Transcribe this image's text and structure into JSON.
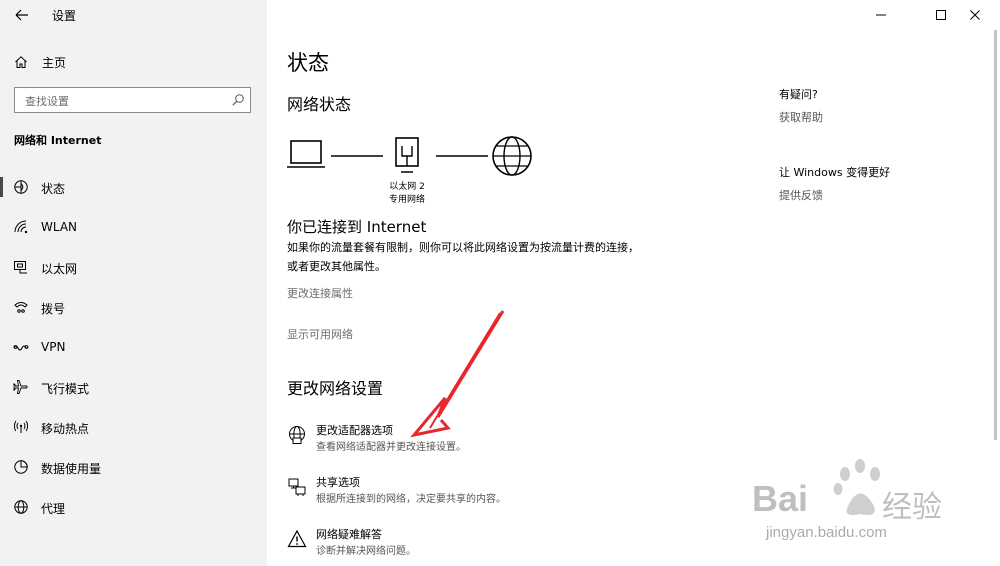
{
  "window": {
    "title": "设置",
    "controls": {
      "minimize": "minimize-icon",
      "maximize": "maximize-icon",
      "close": "close-icon"
    }
  },
  "sidebar": {
    "home_label": "主页",
    "search_placeholder": "查找设置",
    "section_title": "网络和 Internet",
    "items": [
      {
        "label": "状态",
        "icon": "status-icon",
        "active": true
      },
      {
        "label": "WLAN",
        "icon": "wifi-icon"
      },
      {
        "label": "以太网",
        "icon": "ethernet-icon"
      },
      {
        "label": "拨号",
        "icon": "dialup-icon"
      },
      {
        "label": "VPN",
        "icon": "vpn-icon"
      },
      {
        "label": "飞行模式",
        "icon": "airplane-icon"
      },
      {
        "label": "移动热点",
        "icon": "hotspot-icon"
      },
      {
        "label": "数据使用量",
        "icon": "data-usage-icon"
      },
      {
        "label": "代理",
        "icon": "proxy-icon"
      }
    ]
  },
  "main": {
    "page_title": "状态",
    "network_status_heading": "网络状态",
    "diagram": {
      "adapter_name": "以太网 2",
      "network_type": "专用网络"
    },
    "connected_title": "你已连接到 Internet",
    "connected_desc": "如果你的流量套餐有限制，则你可以将此网络设置为按流量计费的连接，或者更改其他属性。",
    "links": {
      "change_properties": "更改连接属性",
      "show_networks": "显示可用网络"
    },
    "change_settings_heading": "更改网络设置",
    "options": [
      {
        "title": "更改适配器选项",
        "desc": "查看网络适配器并更改连接设置。",
        "icon": "adapter-globe-icon"
      },
      {
        "title": "共享选项",
        "desc": "根据所连接到的网络，决定要共享的内容。",
        "icon": "sharing-icon"
      },
      {
        "title": "网络疑难解答",
        "desc": "诊断并解决网络问题。",
        "icon": "warning-icon"
      }
    ]
  },
  "right_panel": {
    "question_heading": "有疑问?",
    "help_link": "获取帮助",
    "improve_heading": "让 Windows 变得更好",
    "feedback_link": "提供反馈"
  },
  "watermark": {
    "brand": "Bai",
    "brand_cn": "经验",
    "url": "jingyan.baidu.com"
  },
  "colors": {
    "sidebar_bg": "#f2f2f2",
    "annotation_arrow": "#e8262c",
    "link_gray": "#6d6d6d"
  }
}
